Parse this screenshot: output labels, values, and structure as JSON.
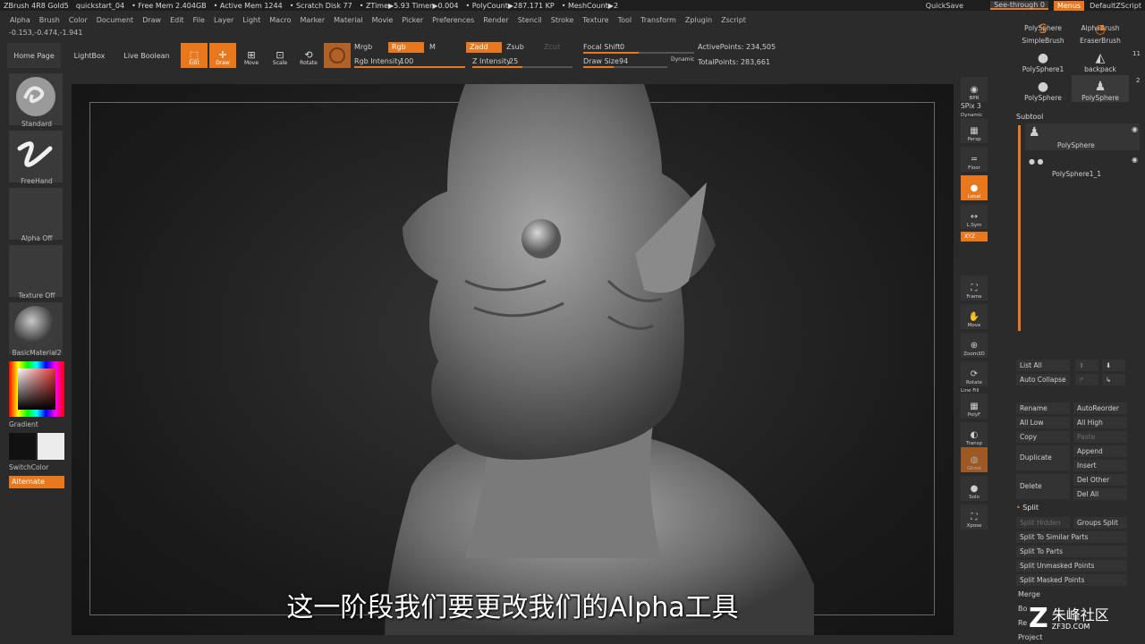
{
  "titlebar": {
    "items": [
      "ZBrush 4R8 Gold5",
      "quickstart_04",
      "• Free Mem 2.404GB",
      "• Active Mem 1244",
      "• Scratch Disk 77",
      "• ZTime▶5.93 Timer▶0.004",
      "• PolyCount▶287.171 KP",
      "• MeshCount▶2"
    ],
    "quicksave": "QuickSave",
    "seethrough": "See-through  0",
    "menus": "Menus",
    "defaultscript": "DefaultZScript"
  },
  "menubar": [
    "Alpha",
    "Brush",
    "Color",
    "Document",
    "Draw",
    "Edit",
    "File",
    "Layer",
    "Light",
    "Macro",
    "Marker",
    "Material",
    "Movie",
    "Picker",
    "Preferences",
    "Render",
    "Stencil",
    "Stroke",
    "Texture",
    "Tool",
    "Transform",
    "Zplugin",
    "Zscript"
  ],
  "coords": "-0.153,-0.474,-1.941",
  "toolbar": {
    "home": "Home Page",
    "lightbox": "LightBox",
    "liveboolean": "Live Boolean",
    "edit": "Edit",
    "draw": "Draw",
    "move": "Move",
    "scale": "Scale",
    "rotate": "Rotate",
    "mrgb": "Mrgb",
    "rgb": "Rgb",
    "m": "M",
    "zadd": "Zadd",
    "zsub": "Zsub",
    "zcut": "Zcut",
    "rgb_intensity_label": "Rgb Intensity",
    "rgb_intensity": "100",
    "z_intensity_label": "Z Intensity",
    "z_intensity": "25",
    "focal_shift_label": "Focal Shift",
    "focal_shift": "0",
    "draw_size_label": "Draw Size",
    "draw_size": "94",
    "dynamic": "Dynamic",
    "active_points": "ActivePoints: 234,505",
    "total_points": "TotalPoints: 283,661"
  },
  "leftpanel": {
    "standard": "Standard",
    "freehand": "FreeHand",
    "alpha": "Alpha Off",
    "texture": "Texture Off",
    "material": "BasicMaterial2",
    "gradient": "Gradient",
    "switchcolor": "SwitchColor",
    "alternate": "Alternate"
  },
  "rshelf": [
    {
      "label": "BPR",
      "glyph": "◉"
    },
    {
      "label": "Persp",
      "glyph": "▦"
    },
    {
      "label": "Floor",
      "glyph": "═"
    },
    {
      "label": "Local",
      "glyph": "●"
    },
    {
      "label": "L.Sym",
      "glyph": "↔"
    },
    {
      "label": "Frame",
      "glyph": "⛶"
    },
    {
      "label": "Move",
      "glyph": "✋"
    },
    {
      "label": "Zoom3D",
      "glyph": "⊕"
    },
    {
      "label": "Rotate",
      "glyph": "⟳"
    },
    {
      "label": "PolyF",
      "glyph": "▦"
    },
    {
      "label": "Transp",
      "glyph": "◐"
    },
    {
      "label": "Ghost",
      "glyph": "◍"
    },
    {
      "label": "Solo",
      "glyph": "●"
    },
    {
      "label": "Xpose",
      "glyph": "⛶"
    }
  ],
  "spix": "SPix 3",
  "dynamic_label": "Dynamic",
  "linefill": "Line Fill",
  "xyz": "XYZ",
  "rpanel": {
    "polysphere_top": "PolySphere",
    "alphabrush_top": "AlphaBrush",
    "simplebrush": "SimpleBrush",
    "eraserbrush": "EraserBrush",
    "polysphere1": "PolySphere1",
    "backpack": "backpack",
    "polysphere": "PolySphere",
    "polysphere_2": "PolySphere",
    "count_11": "11",
    "count_2": "2",
    "subtool": "Subtool",
    "sub1": "PolySphere",
    "sub2": "PolySphere1_1",
    "listall": "List All",
    "autocollapse": "Auto Collapse",
    "rename": "Rename",
    "autoreorder": "AutoReorder",
    "alllow": "All Low",
    "allhigh": "All High",
    "copy": "Copy",
    "paste": "Paste",
    "duplicate": "Duplicate",
    "append": "Append",
    "insert": "Insert",
    "delete": "Delete",
    "delother": "Del Other",
    "delall": "Del All",
    "split": "Split",
    "splithidden": "Split Hidden",
    "groupssplit": "Groups Split",
    "splitsimilar": "Split To Similar Parts",
    "splitparts": "Split To Parts",
    "splitunmasked": "Split Unmasked Points",
    "splitmasked": "Split Masked Points",
    "merge": "Merge",
    "boolean": "Bo",
    "remesh": "Re",
    "project": "Project"
  },
  "subtitle": "这一阶段我们要更改我们的Alpha工具",
  "watermark": {
    "text": "朱峰社区",
    "site": "ZF3D.COM"
  }
}
